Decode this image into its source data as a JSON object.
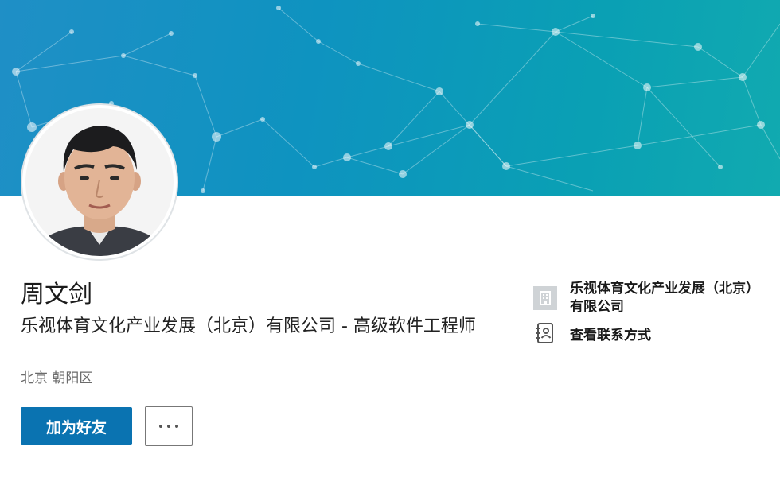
{
  "profile": {
    "name": "周文剑",
    "headline": "乐视体育文化产业发展（北京）有限公司 - 高级软件工程师",
    "location": "北京 朝阳区"
  },
  "actions": {
    "connect_label": "加为好友",
    "more_icon": "more-horizontal-icon"
  },
  "sidebar": {
    "company_name": "乐视体育文化产业发展（北京）有限公司",
    "company_icon": "building-icon",
    "contact_label": "查看联系方式",
    "contact_icon": "address-book-icon"
  },
  "colors": {
    "banner": "#0e93c0",
    "primary_button": "#0a73b1"
  }
}
